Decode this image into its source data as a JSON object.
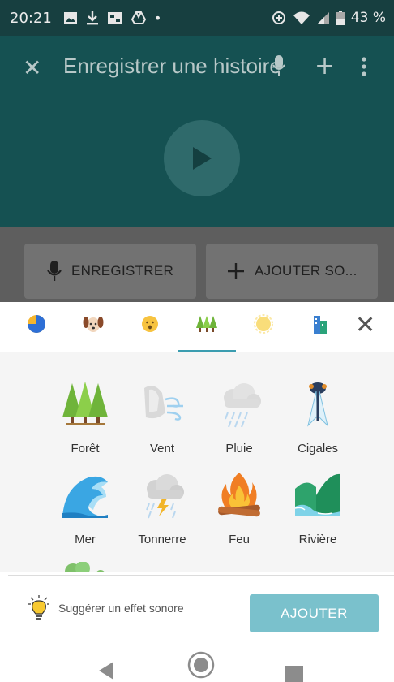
{
  "status_bar": {
    "time": "20:21",
    "dot": "•",
    "battery": "43 %"
  },
  "app_bar": {
    "title": "Enregistrer une histoire",
    "close_icon": "close-icon",
    "add_icon": "plus-icon",
    "more_icon": "more-vert-icon"
  },
  "actions": {
    "record_label": "ENREGISTRER",
    "add_sound_label": "AJOUTER SO..."
  },
  "tabs": [
    {
      "icon": "pie-chart-icon"
    },
    {
      "icon": "dog-icon"
    },
    {
      "icon": "surprised-face-icon"
    },
    {
      "icon": "forest-icon",
      "selected": true
    },
    {
      "icon": "sun-icon"
    },
    {
      "icon": "city-icon"
    }
  ],
  "sounds": [
    {
      "name": "Forêt",
      "icon": "forest-icon"
    },
    {
      "name": "Vent",
      "icon": "wind-icon"
    },
    {
      "name": "Pluie",
      "icon": "rain-cloud-icon"
    },
    {
      "name": "Cigales",
      "icon": "cicada-icon"
    },
    {
      "name": "Mer",
      "icon": "wave-icon"
    },
    {
      "name": "Tonnerre",
      "icon": "thunder-cloud-icon"
    },
    {
      "name": "Feu",
      "icon": "campfire-icon"
    },
    {
      "name": "Rivière",
      "icon": "river-icon"
    }
  ],
  "footer": {
    "suggest_label": "Suggérer un effet sonore",
    "add_button": "AJOUTER"
  },
  "colors": {
    "accent": "#3b9db0",
    "add_button": "#7ac1cc",
    "app_bar_dimmed": "#155152"
  }
}
